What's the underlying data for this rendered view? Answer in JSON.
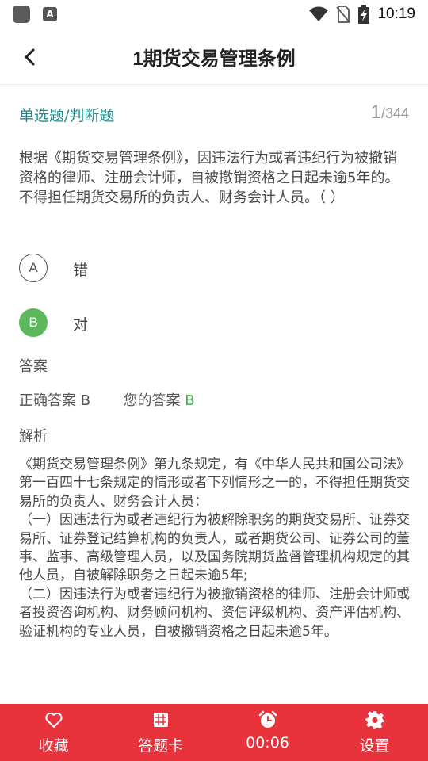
{
  "status_bar": {
    "time": "10:19",
    "notification_icon": "A"
  },
  "header": {
    "title": "1期货交易管理条例"
  },
  "question_info": {
    "type": "单选题/判断题",
    "current": "1",
    "total": "/344"
  },
  "question": {
    "text": "根据《期货交易管理条例》，因违法行为或者违纪行为被撤销资格的律师、注册会计师，自被撤销资格之日起未逾5年的。不得担任期货交易所的负责人、财务会计人员。（ ）"
  },
  "options": [
    {
      "letter": "A",
      "text": "错",
      "state": "normal"
    },
    {
      "letter": "B",
      "text": "对",
      "state": "correct"
    }
  ],
  "answer": {
    "heading": "答案",
    "correct_label": "正确答案",
    "correct_value": "B",
    "yours_label": "您的答案",
    "yours_value": "B"
  },
  "analysis": {
    "heading": "解析",
    "paragraphs": [
      "《期货交易管理条例》第九条规定，有《中华人民共和国公司法》第一百四十七条规定的情形或者下列情形之一的，不得担任期货交易所的负责人、财务会计人员：",
      "（一）因违法行为或者违纪行为被解除职务的期货交易所、证券交易所、证券登记结算机构的负责人，或者期货公司、证券公司的董事、监事、高级管理人员，以及国务院期货监督管理机构规定的其他人员，自被解除职务之日起未逾5年;",
      "（二）因违法行为或者违纪行为被撤销资格的律师、注册会计师或者投资咨询机构、财务顾问机构、资信评级机构、资产评估机构、验证机构的专业人员，自被撤销资格之日起未逾5年。"
    ]
  },
  "bottom_bar": {
    "favorite": "收藏",
    "answer_card": "答题卡",
    "timer": "00:06",
    "settings": "设置"
  },
  "colors": {
    "accent_red": "#e8323c",
    "correct_green": "#5cb85c",
    "type_teal": "#1f8a8a"
  }
}
